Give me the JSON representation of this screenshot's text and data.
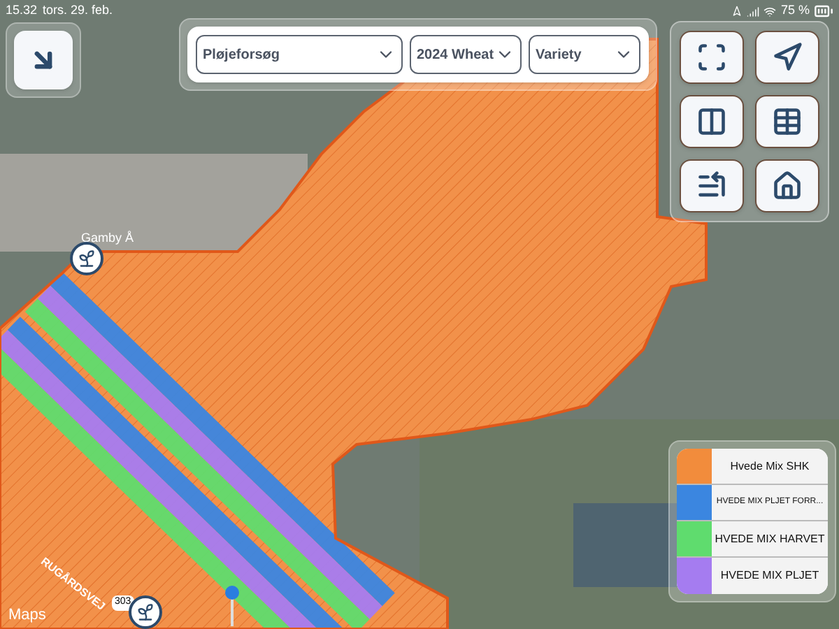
{
  "status_bar": {
    "time": "15.32",
    "date": "tors. 29. feb.",
    "battery": "75 %"
  },
  "filters": [
    {
      "value": "Pløjeforsøg"
    },
    {
      "value": "2024 Wheat"
    },
    {
      "value": "Variety"
    }
  ],
  "map": {
    "labels": [
      {
        "kind": "place",
        "text": "Gamby Å"
      },
      {
        "kind": "road",
        "text": "RUGÅRDSVEJ"
      },
      {
        "kind": "route",
        "text": "303"
      },
      {
        "kind": "attribution",
        "text": "Maps"
      }
    ]
  },
  "legend": [
    {
      "label": "Hvede Mix SHK",
      "color": "#f28c3c"
    },
    {
      "label": "HVEDE MIX PLJET FORR...",
      "color": "#3b86e0"
    },
    {
      "label": "HVEDE MIX HARVET",
      "color": "#5fdc6e"
    },
    {
      "label": "HVEDE MIX PLJET",
      "color": "#a57cf0"
    }
  ]
}
